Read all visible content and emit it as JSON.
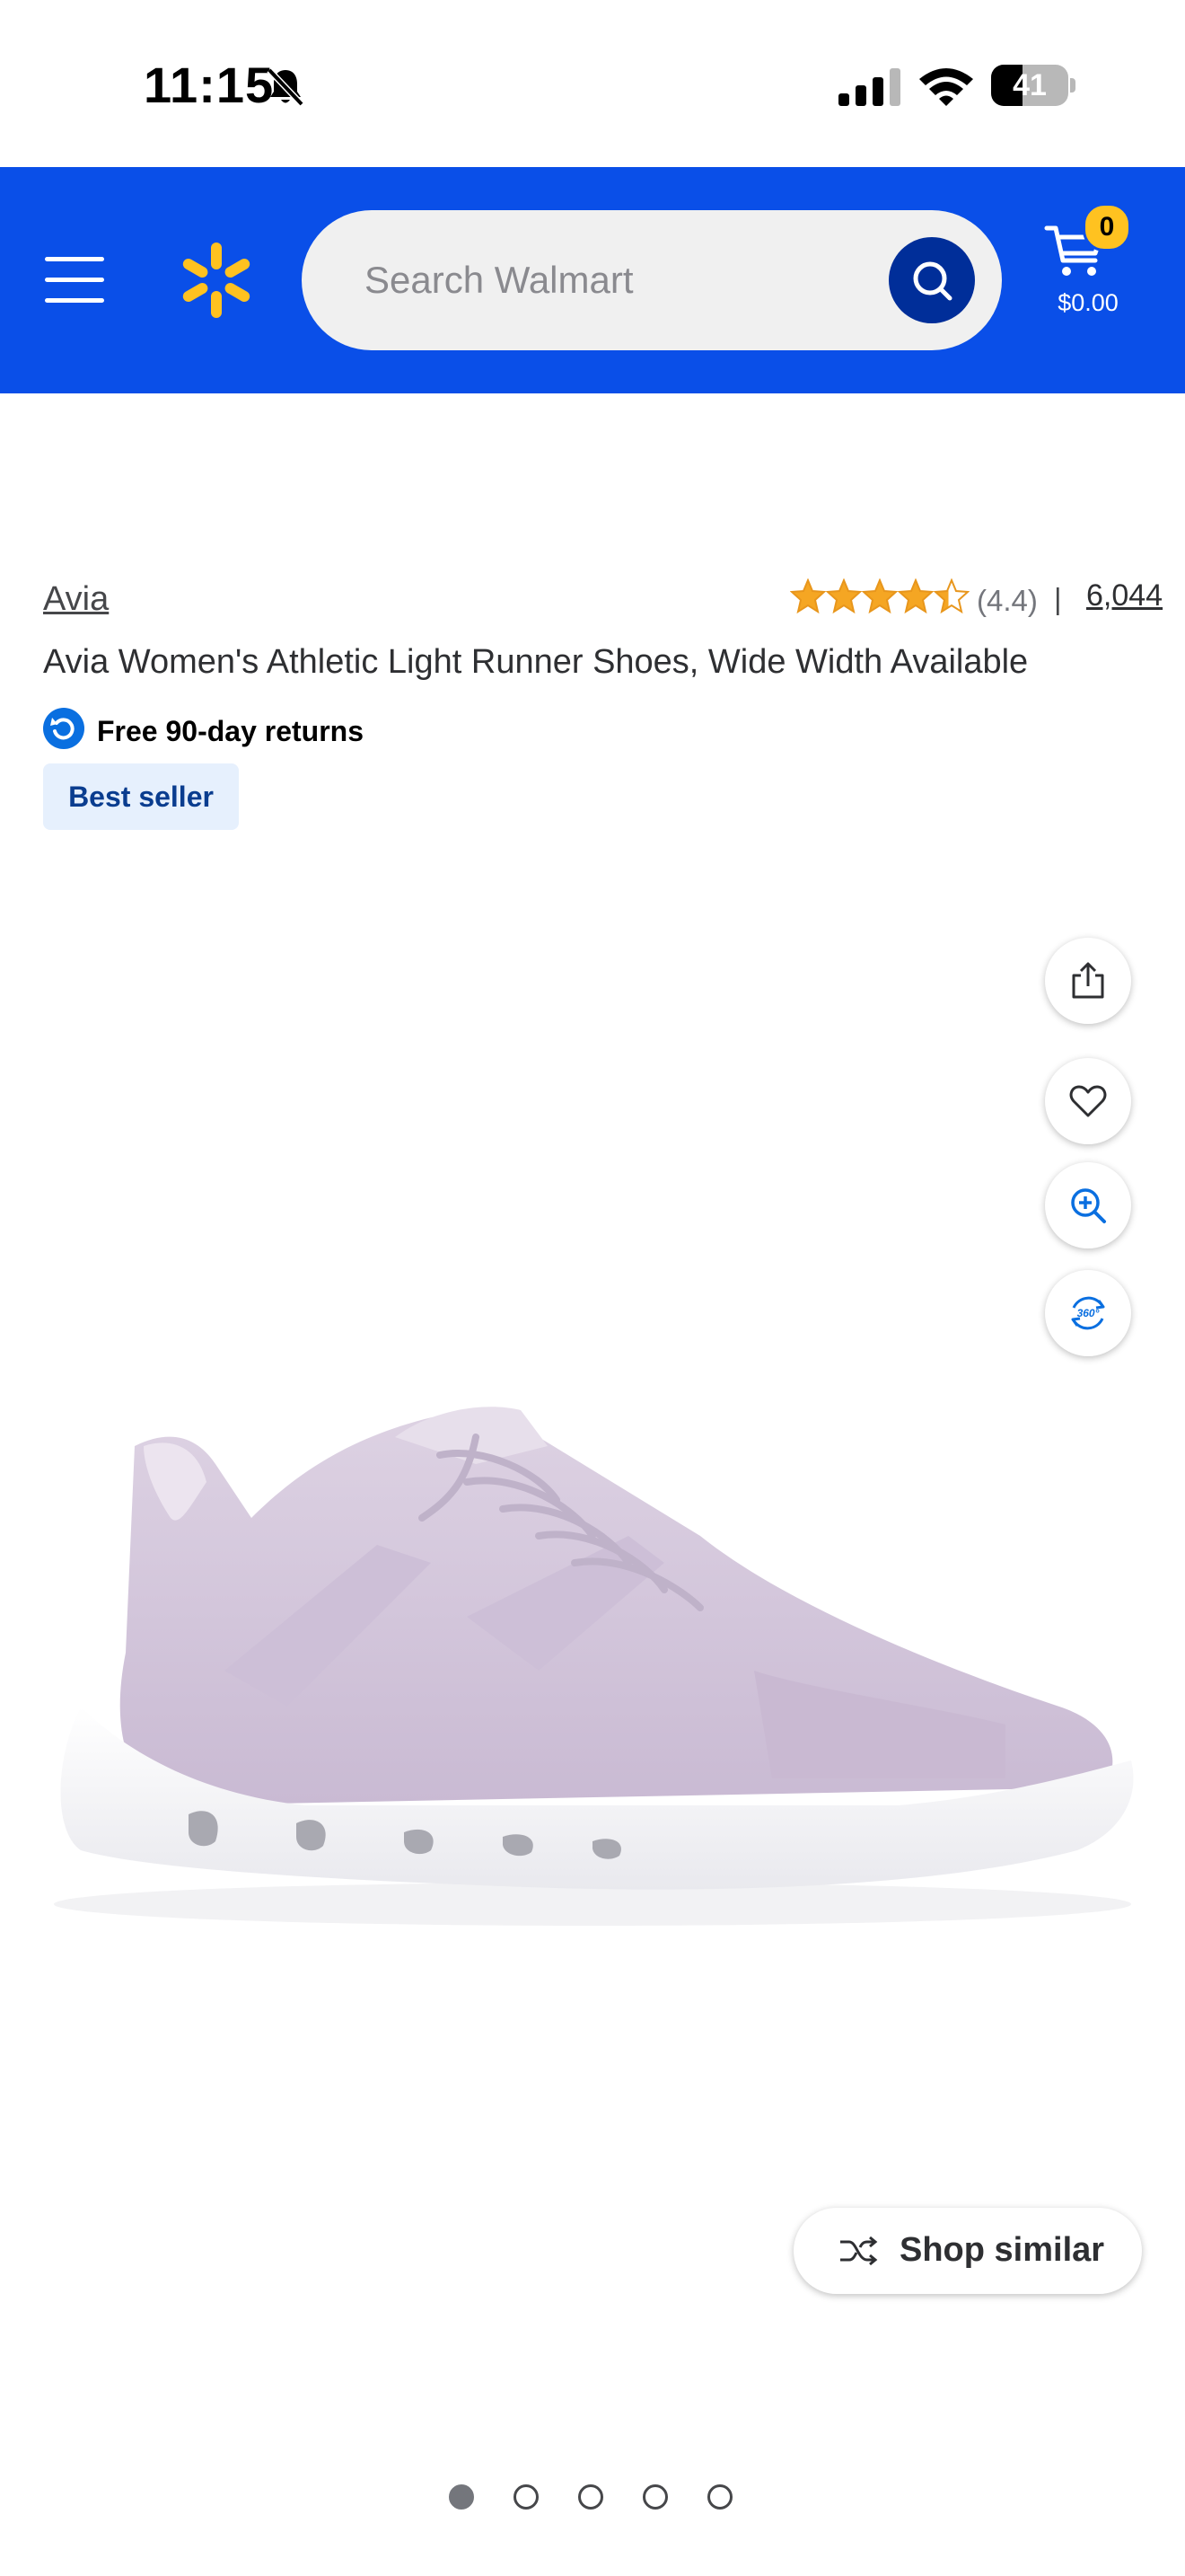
{
  "status_bar": {
    "time": "11:15",
    "battery_percent": 41,
    "battery_label": "41",
    "silent_icon": "bell-slash-icon",
    "signal_icon": "cellular-signal-icon",
    "wifi_icon": "wifi-icon"
  },
  "header": {
    "menu_icon": "hamburger-menu-icon",
    "logo_icon": "walmart-spark-icon",
    "search": {
      "placeholder": "Search Walmart",
      "value": ""
    },
    "search_icon": "search-icon",
    "cart": {
      "count": "0",
      "total": "$0.00"
    }
  },
  "product": {
    "brand": "Avia",
    "rating_value": 4.4,
    "rating_label": "(4.4)",
    "rating_separator": "|",
    "review_count": "6,044",
    "title": "Avia Women's Athletic Light Runner Shoes, Wide Width Available",
    "returns_text": "Free 90-day returns",
    "badge": "Best seller"
  },
  "image_actions": [
    "share-icon",
    "heart-icon",
    "zoom-in-icon",
    "view-360-icon"
  ],
  "image_actions_360_label": "360°",
  "shop_similar_label": "Shop similar",
  "carousel": {
    "total": 5,
    "active_index": 0
  },
  "colors": {
    "brand_blue": "#0a4fe8",
    "dark_blue": "#002e99",
    "spark_yellow": "#ffc220",
    "badge_bg": "#e6f0fd",
    "badge_text": "#0a3d8f",
    "shoe_lavender": "#d9cde0"
  }
}
